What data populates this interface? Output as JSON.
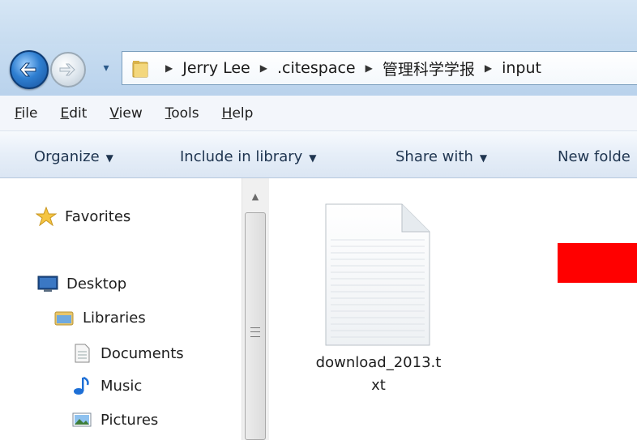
{
  "address": {
    "breadcrumbs": [
      "Jerry Lee",
      ".citespace",
      "管理科学学报",
      "input"
    ],
    "folder_icon": "folder-icon",
    "back_icon": "back-arrow-icon",
    "forward_icon": "forward-arrow-icon"
  },
  "menubar": {
    "items": [
      {
        "first": "F",
        "rest": "ile"
      },
      {
        "first": "E",
        "rest": "dit"
      },
      {
        "first": "V",
        "rest": "iew"
      },
      {
        "first": "T",
        "rest": "ools"
      },
      {
        "first": "H",
        "rest": "elp"
      }
    ]
  },
  "commandbar": {
    "organize": "Organize",
    "include": "Include in library",
    "share": "Share with",
    "newfolder": "New folde"
  },
  "navpane": {
    "favorites": "Favorites",
    "desktop": "Desktop",
    "libraries": "Libraries",
    "documents": "Documents",
    "music": "Music",
    "pictures": "Pictures"
  },
  "content": {
    "file_name_line1": "download_2013.t",
    "file_name_line2": "xt"
  },
  "colors": {
    "redaction": "#ff0000",
    "accent": "#2f7fd1"
  }
}
